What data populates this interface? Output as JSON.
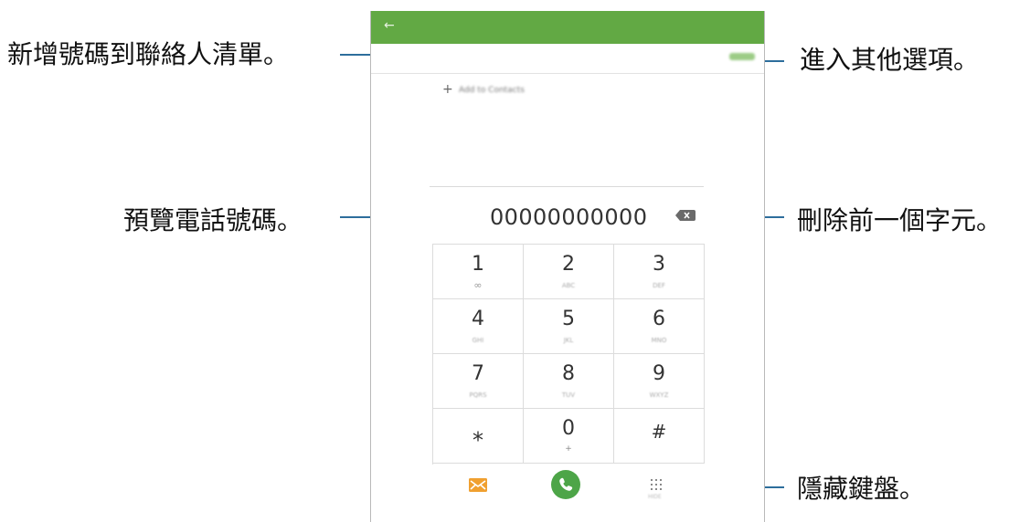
{
  "callouts": {
    "add_contact": "新增號碼到聯絡人清單。",
    "more_options": "進入其他選項。",
    "preview_number": "預覽電話號碼。",
    "delete_char": "刪除前一個字元。",
    "hide_keypad": "隱藏鍵盤。"
  },
  "phone": {
    "back_icon": "arrow-left-icon",
    "more_label": "MORE",
    "add_to_contacts": "Add to Contacts",
    "number": "00000000000",
    "keys": [
      {
        "digit": "1",
        "sub": "∞"
      },
      {
        "digit": "2",
        "sub": "ABC"
      },
      {
        "digit": "3",
        "sub": "DEF"
      },
      {
        "digit": "4",
        "sub": "GHI"
      },
      {
        "digit": "5",
        "sub": "JKL"
      },
      {
        "digit": "6",
        "sub": "MNO"
      },
      {
        "digit": "7",
        "sub": "PQRS"
      },
      {
        "digit": "8",
        "sub": "TUV"
      },
      {
        "digit": "9",
        "sub": "WXYZ"
      },
      {
        "digit": "⁎",
        "sub": ""
      },
      {
        "digit": "0",
        "sub": "+"
      },
      {
        "digit": "#",
        "sub": ""
      }
    ],
    "hide_label": "HIDE"
  },
  "colors": {
    "header_green": "#62a944",
    "call_green": "#4da548",
    "message_orange": "#f0a030",
    "callout_line": "#2d6e9c"
  }
}
